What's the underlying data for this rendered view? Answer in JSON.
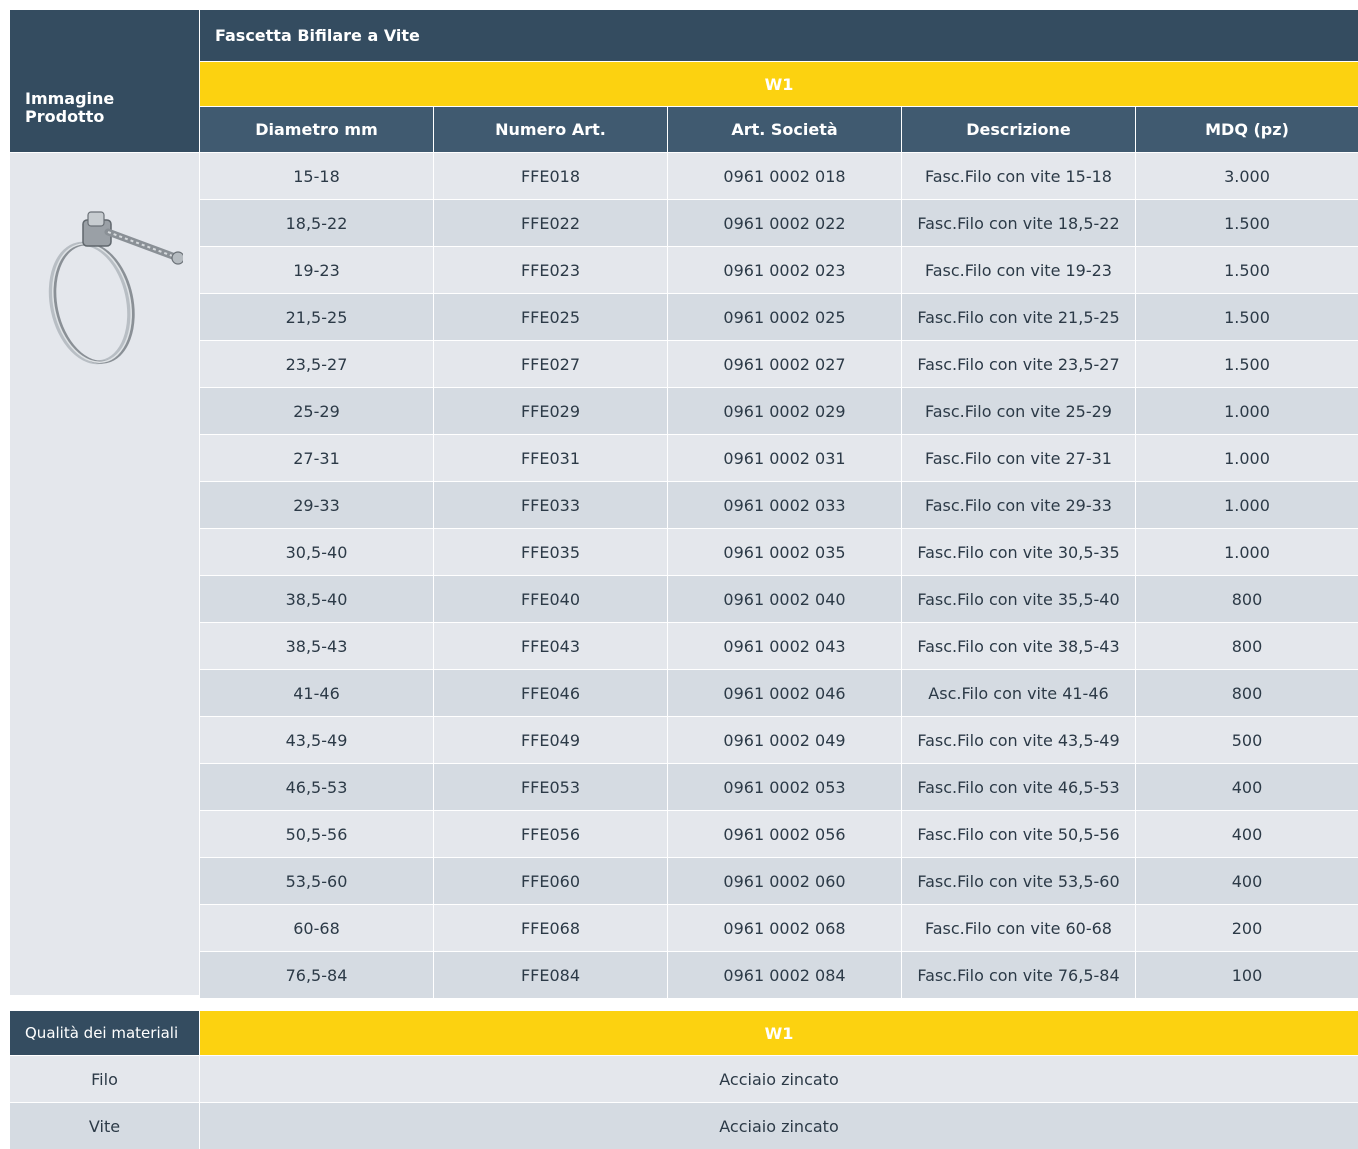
{
  "table": {
    "product_title": "Fascetta Bifilare a Vite",
    "image_col_label": "Immagine Prodotto",
    "variant": "W1",
    "columns": [
      "Diametro mm",
      "Numero Art.",
      "Art. Società",
      "Descrizione",
      "MDQ (pz)"
    ],
    "rows": [
      [
        "15-18",
        "FFE018",
        "0961 0002 018",
        "Fasc.Filo con vite 15-18",
        "3.000"
      ],
      [
        "18,5-22",
        "FFE022",
        "0961 0002 022",
        "Fasc.Filo con vite 18,5-22",
        "1.500"
      ],
      [
        "19-23",
        "FFE023",
        "0961 0002 023",
        "Fasc.Filo con vite 19-23",
        "1.500"
      ],
      [
        "21,5-25",
        "FFE025",
        "0961 0002 025",
        "Fasc.Filo con vite 21,5-25",
        "1.500"
      ],
      [
        "23,5-27",
        "FFE027",
        "0961 0002 027",
        "Fasc.Filo con vite 23,5-27",
        "1.500"
      ],
      [
        "25-29",
        "FFE029",
        "0961 0002 029",
        "Fasc.Filo con vite 25-29",
        "1.000"
      ],
      [
        "27-31",
        "FFE031",
        "0961 0002 031",
        "Fasc.Filo con vite 27-31",
        "1.000"
      ],
      [
        "29-33",
        "FFE033",
        "0961 0002 033",
        "Fasc.Filo con vite 29-33",
        "1.000"
      ],
      [
        "30,5-40",
        "FFE035",
        "0961 0002 035",
        "Fasc.Filo con vite 30,5-35",
        "1.000"
      ],
      [
        "38,5-40",
        "FFE040",
        "0961 0002 040",
        "Fasc.Filo con vite 35,5-40",
        "800"
      ],
      [
        "38,5-43",
        "FFE043",
        "0961 0002 043",
        "Fasc.Filo con vite 38,5-43",
        "800"
      ],
      [
        "41-46",
        "FFE046",
        "0961 0002 046",
        "Asc.Filo con vite 41-46",
        "800"
      ],
      [
        "43,5-49",
        "FFE049",
        "0961 0002 049",
        "Fasc.Filo con vite 43,5-49",
        "500"
      ],
      [
        "46,5-53",
        "FFE053",
        "0961 0002 053",
        "Fasc.Filo con vite 46,5-53",
        "400"
      ],
      [
        "50,5-56",
        "FFE056",
        "0961 0002 056",
        "Fasc.Filo con vite 50,5-56",
        "400"
      ],
      [
        "53,5-60",
        "FFE060",
        "0961 0002 060",
        "Fasc.Filo con vite 53,5-60",
        "400"
      ],
      [
        "60-68",
        "FFE068",
        "0961 0002 068",
        "Fasc.Filo con vite 60-68",
        "200"
      ],
      [
        "76,5-84",
        "FFE084",
        "0961 0002 084",
        "Fasc.Filo con vite 76,5-84",
        "100"
      ]
    ]
  },
  "materials": {
    "header_label": "Qualità dei materiali",
    "variant": "W1",
    "rows": [
      [
        "Filo",
        "Acciaio zincato"
      ],
      [
        "Vite",
        "Acciaio zincato"
      ]
    ]
  },
  "colors": {
    "header_dark": "#344c60",
    "header_mid": "#405a70",
    "accent_yellow": "#fcd210",
    "row_light": "#e4e7ec",
    "row_dark": "#d5dbe2"
  },
  "icons": {
    "product_image": "wire-hose-clamp-icon"
  }
}
